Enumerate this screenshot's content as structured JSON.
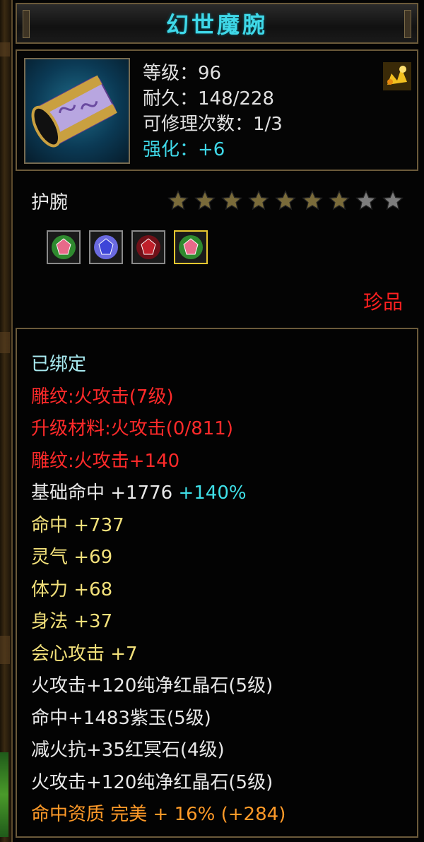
{
  "title": "幻世魔腕",
  "item_icon": "purple-bracer-icon",
  "level_text": "等级：96",
  "durability_text": "耐久：148/228",
  "repair_text": "可修理次数：1/3",
  "enhance_text": "强化：+6",
  "corner_icon": "gold-emblem-icon",
  "type_label": "护腕",
  "stars": {
    "filled": 7,
    "total": 9,
    "filled_color": "#7a6b3a",
    "empty_color": "#7d7d7d"
  },
  "gems": [
    {
      "icon": "pink-gem-icon",
      "color": "#e86a8a",
      "ring": "#2f8a2f",
      "selected": false
    },
    {
      "icon": "blue-gem-icon",
      "color": "#3d45d8",
      "ring": "#6a6ae0",
      "selected": false
    },
    {
      "icon": "red-gem-icon",
      "color": "#c0202a",
      "ring": "#701018",
      "selected": false
    },
    {
      "icon": "pink-gem-icon",
      "color": "#e86a8a",
      "ring": "#2f8a2f",
      "selected": true
    }
  ],
  "rarity": "珍品",
  "attributes": [
    {
      "text": "已绑定",
      "color": "cyan"
    },
    {
      "text": "雕纹:火攻击(7级)",
      "color": "red"
    },
    {
      "text": "升级材料:火攻击(0/811)",
      "color": "red"
    },
    {
      "text": "雕纹:火攻击+140",
      "color": "red"
    },
    {
      "text": "基础命中 +1776 ",
      "extra": "+140%",
      "color": "white"
    },
    {
      "text": "命中 +737",
      "color": "yellow"
    },
    {
      "text": "灵气 +69",
      "color": "yellow"
    },
    {
      "text": "体力 +68",
      "color": "yellow"
    },
    {
      "text": "身法 +37",
      "color": "yellow"
    },
    {
      "text": "会心攻击 +7",
      "color": "yellow"
    },
    {
      "text": "火攻击+120纯净红晶石(5级)",
      "color": "white"
    },
    {
      "text": "命中+1483紫玉(5级)",
      "color": "white"
    },
    {
      "text": "减火抗+35红冥石(4级)",
      "color": "white"
    },
    {
      "text": "火攻击+120纯净红晶石(5级)",
      "color": "white"
    },
    {
      "text": "命中资质 完美 + 16% (+284)",
      "color": "orange"
    }
  ]
}
